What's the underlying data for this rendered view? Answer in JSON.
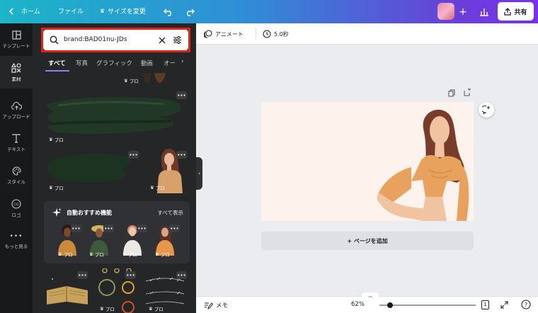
{
  "topbar": {
    "home_label": "ホーム",
    "file_label": "ファイル",
    "resize_label": "サイズを変更",
    "share_label": "共有"
  },
  "rail": {
    "items": [
      {
        "label": "テンプレート",
        "icon": "template-icon"
      },
      {
        "label": "素材",
        "icon": "elements-icon"
      },
      {
        "label": "アップロード",
        "icon": "upload-icon"
      },
      {
        "label": "テキスト",
        "icon": "text-icon"
      },
      {
        "label": "スタイル",
        "icon": "palette-icon"
      },
      {
        "label": "ロゴ",
        "icon": "logo-icon"
      },
      {
        "label": "もっと見る",
        "icon": "more-icon"
      }
    ]
  },
  "search": {
    "value": "brand:BAD01nu-JDs"
  },
  "tabs": [
    "すべて",
    "写真",
    "グラフィック",
    "動画",
    "オー"
  ],
  "pro_label": "プロ",
  "more_label": "•••",
  "recommend": {
    "title": "自動おすすめ機能",
    "show_all": "すべて表示"
  },
  "toolbar2": {
    "animate_label": "アニメート",
    "duration_label": "5.0秒"
  },
  "canvas": {
    "add_page_label": "+ ページを追加"
  },
  "bottombar": {
    "notes_label": "メモ",
    "zoom_label": "62%",
    "page_count": "1",
    "zoom_fraction": 0.62
  },
  "colors": {
    "accent": "#8d7cf0",
    "highlight": "#e2231a",
    "canvas_bg": "#fdf2ec"
  }
}
